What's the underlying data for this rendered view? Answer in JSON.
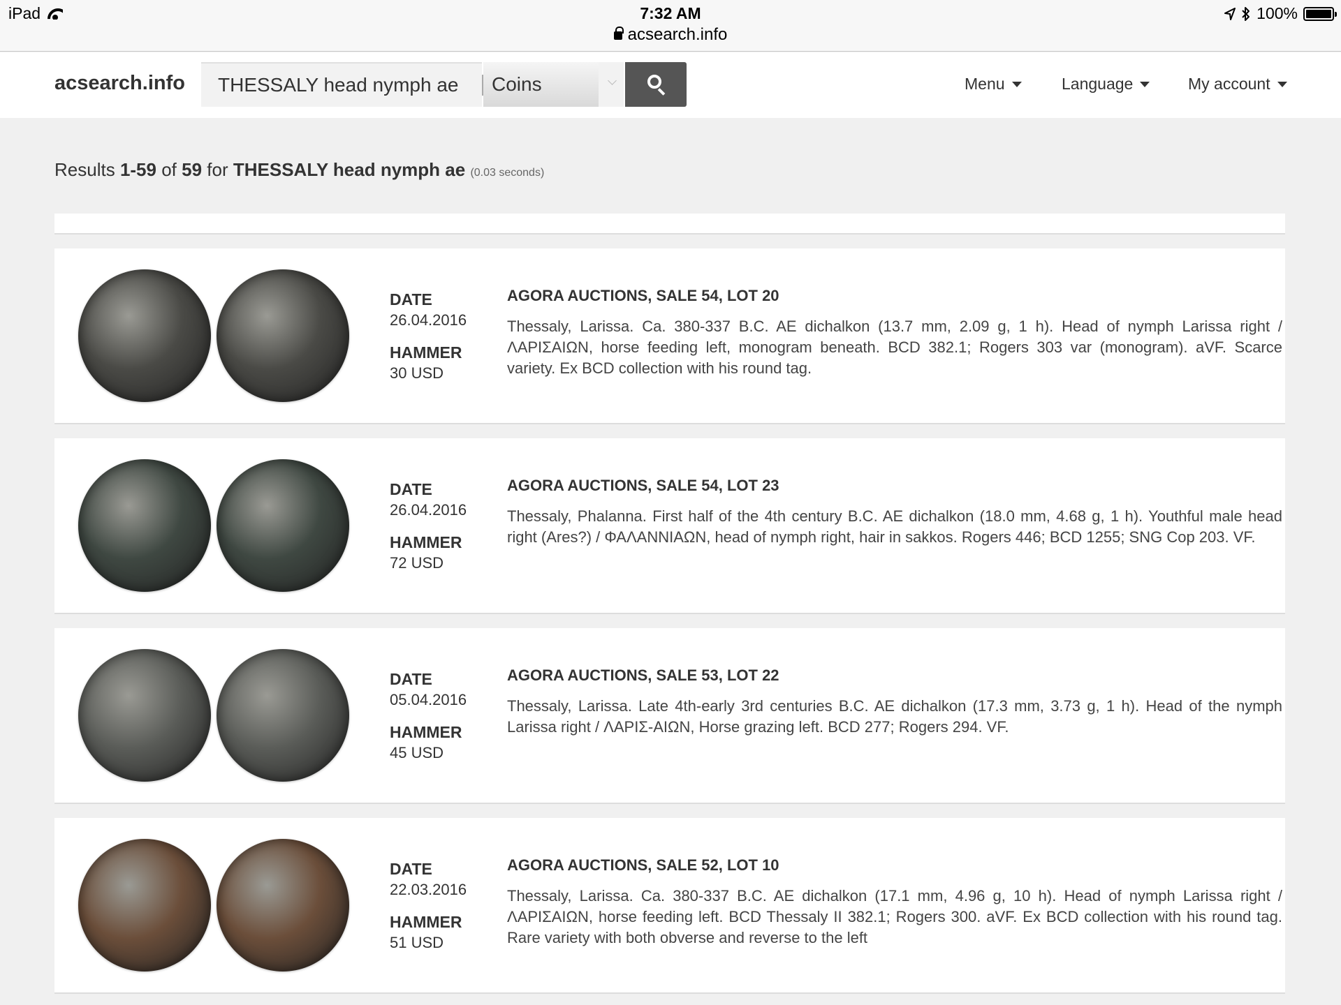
{
  "status_bar": {
    "device": "iPad",
    "time": "7:32 AM",
    "url": "acsearch.info",
    "battery": "100%"
  },
  "header": {
    "brand": "acsearch.info",
    "search_value": "THESSALY head nymph ae",
    "category": "Coins",
    "nav": {
      "menu": "Menu",
      "language": "Language",
      "account": "My account"
    }
  },
  "summary": {
    "prefix": "Results",
    "range": "1-59",
    "of": "of",
    "total": "59",
    "for": "for",
    "query": "THESSALY head nymph ae",
    "time": "(0.03 seconds)"
  },
  "labels": {
    "date": "DATE",
    "hammer": "HAMMER"
  },
  "results": [
    {
      "date": "26.04.2016",
      "hammer": "30 USD",
      "title": "AGORA AUCTIONS, SALE 54, LOT 20",
      "description": "Thessaly, Larissa. Ca. 380-337 B.C. AE dichalkon (13.7 mm, 2.09 g, 1 h). Head of nymph Larissa right / ΛΑΡΙΣΑΙΩΝ, horse feeding left, monogram beneath. BCD 382.1; Rogers 303 var (monogram). aVF. Scarce variety.  Ex BCD collection with his round tag.",
      "coin_color": "#4a4a46"
    },
    {
      "date": "26.04.2016",
      "hammer": "72 USD",
      "title": "AGORA AUCTIONS, SALE 54, LOT 23",
      "description": "Thessaly, Phalanna. First half of the 4th century B.C. AE dichalkon (18.0 mm, 4.68 g, 1 h). Youthful male head right (Ares?) / ΦΑΛΑΝΝΙΑΩΝ, head of nymph right, hair in sakkos. Rogers 446; BCD 1255; SNG Cop 203. VF.",
      "coin_color": "#3f4842"
    },
    {
      "date": "05.04.2016",
      "hammer": "45 USD",
      "title": "AGORA AUCTIONS, SALE 53, LOT 22",
      "description": "Thessaly, Larissa. Late 4th-early 3rd centuries B.C. AE dichalkon (17.3 mm, 3.73 g, 1 h). Head of the nymph Larissa right / ΛΑΡΙΣ-ΑΙΩΝ, Horse grazing left. BCD 277; Rogers 294. VF.",
      "coin_color": "#5a5c58"
    },
    {
      "date": "22.03.2016",
      "hammer": "51 USD",
      "title": "AGORA AUCTIONS, SALE 52, LOT 10",
      "description": "Thessaly, Larissa. Ca. 380-337 B.C. AE dichalkon (17.1 mm, 4.96 g, 10 h). Head of nymph Larissa right / ΛΑΡΙΣΑΙΩΝ, horse feeding left. BCD Thessaly II 382.1; Rogers 300. aVF.  Ex BCD collection with his round tag.  Rare variety with both obverse and reverse to the left",
      "coin_color": "#6b4e3a"
    }
  ]
}
